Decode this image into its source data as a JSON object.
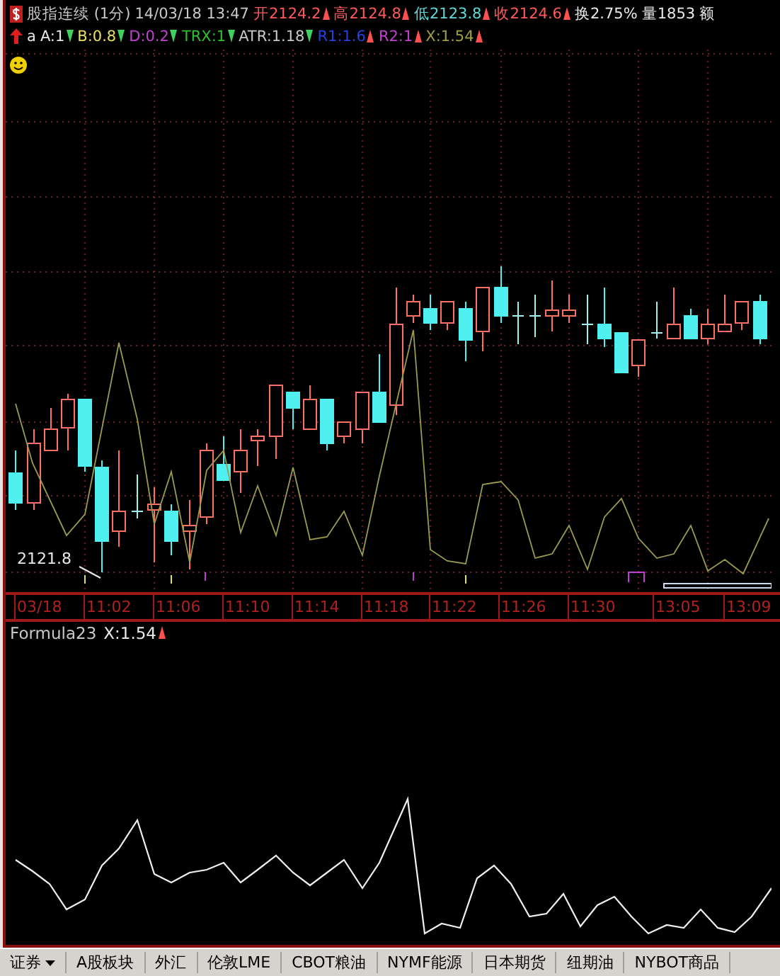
{
  "header": {
    "title": "股指连续 (1分)",
    "datetime": "14/03/18 13:47",
    "quotes": [
      {
        "label": "开",
        "value": "2124.2",
        "color": "#ff5a5a",
        "kind": "up"
      },
      {
        "label": "高",
        "value": "2124.8",
        "color": "#ff5a5a",
        "kind": "up"
      },
      {
        "label": "低",
        "value": "2123.8",
        "color": "#5fd8d8",
        "kind": "up"
      },
      {
        "label": "收",
        "value": "2124.6",
        "color": "#ff5a5a",
        "kind": "up"
      }
    ],
    "turnover": "换2.75%",
    "volume": "量1853",
    "amount": "额",
    "indicator_prefix": "a",
    "indicators": [
      {
        "name": "A:1",
        "color": "#e8e8e8",
        "kind": "down"
      },
      {
        "name": "B:0.8",
        "color": "#e6e060",
        "kind": "down"
      },
      {
        "name": "D:0.2",
        "color": "#c040d0",
        "kind": "down"
      },
      {
        "name": "TRX:1",
        "color": "#30c030",
        "kind": "down"
      },
      {
        "name": "ATR:1.18",
        "color": "#c8c8c8",
        "kind": "down"
      },
      {
        "name": "R1:1.6",
        "color": "#2840e0",
        "kind": "up"
      },
      {
        "name": "R2:1",
        "color": "#c040d0",
        "kind": "up"
      },
      {
        "name": "X:1.54",
        "color": "#a0a040",
        "kind": "up"
      }
    ]
  },
  "price_label": "2121.8",
  "time_axis": [
    "03/18",
    "11:02",
    "11:06",
    "11:10",
    "11:14",
    "11:18",
    "11:22",
    "11:26",
    "11:30",
    "13:05",
    "13:09"
  ],
  "lower_pane": {
    "title": "Formula23",
    "value": "X:1.54",
    "kind": "up"
  },
  "tabs": [
    {
      "label": "证券",
      "dropdown": true
    },
    {
      "label": "A股板块",
      "dropdown": false
    },
    {
      "label": "外汇",
      "dropdown": false
    },
    {
      "label": "伦敦LME",
      "dropdown": false
    },
    {
      "label": "CBOT粮油",
      "dropdown": false
    },
    {
      "label": "NYMF能源",
      "dropdown": false
    },
    {
      "label": "日本期货",
      "dropdown": false
    },
    {
      "label": "纽期油",
      "dropdown": false
    },
    {
      "label": "NYBOT商品",
      "dropdown": false
    }
  ]
}
